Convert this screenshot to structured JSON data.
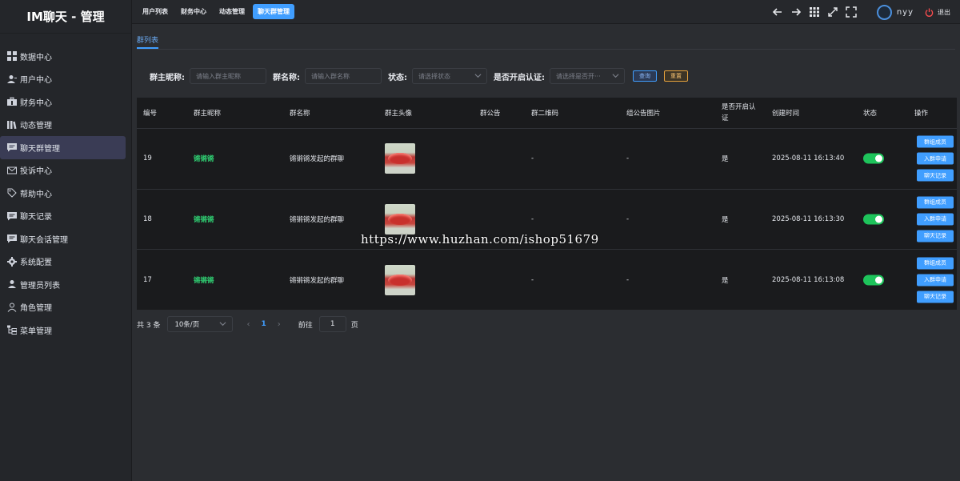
{
  "app": {
    "title": "IM聊天 - 管理"
  },
  "sidebar": {
    "items": [
      {
        "label": "数据中心",
        "icon": "grid-icon",
        "active": false
      },
      {
        "label": "用户中心",
        "icon": "user-icon",
        "active": false
      },
      {
        "label": "财务中心",
        "icon": "briefcase-icon",
        "active": false
      },
      {
        "label": "动态管理",
        "icon": "library-icon",
        "active": false
      },
      {
        "label": "聊天群管理",
        "icon": "chat-icon",
        "active": true
      },
      {
        "label": "投诉中心",
        "icon": "mail-icon",
        "active": false
      },
      {
        "label": "帮助中心",
        "icon": "tag-icon",
        "active": false
      },
      {
        "label": "聊天记录",
        "icon": "chat-icon",
        "active": false
      },
      {
        "label": "聊天会话管理",
        "icon": "chat-icon",
        "active": false
      },
      {
        "label": "系统配置",
        "icon": "gear-icon",
        "active": false
      },
      {
        "label": "管理员列表",
        "icon": "user-icon",
        "active": false
      },
      {
        "label": "角色管理",
        "icon": "user-outline-icon",
        "active": false
      },
      {
        "label": "菜单管理",
        "icon": "tree-icon",
        "active": false
      }
    ]
  },
  "topbar": {
    "tabs": [
      {
        "label": "用户列表",
        "active": false
      },
      {
        "label": "财务中心",
        "active": false
      },
      {
        "label": "动态管理",
        "active": false
      },
      {
        "label": "聊天群管理",
        "active": true
      }
    ],
    "username": "nyy",
    "logout_label": "退出"
  },
  "subtabs": {
    "active": "群列表"
  },
  "filters": {
    "owner_label": "群主昵称:",
    "owner_placeholder": "请输入群主昵称",
    "group_label": "群名称:",
    "group_placeholder": "请输入群名称",
    "status_label": "状态:",
    "status_placeholder": "请选择状态",
    "verify_label": "是否开启认证:",
    "verify_placeholder": "请选择是否开···",
    "query_label": "查询",
    "reset_label": "重置"
  },
  "table": {
    "headers": {
      "id": "编号",
      "owner": "群主昵称",
      "name": "群名称",
      "avatar": "群主头像",
      "notice": "群公告",
      "qrcode": "群二维码",
      "notice_img": "组公告图片",
      "verify_line1": "是否开启认",
      "verify_line2": "证",
      "created": "创建时间",
      "status": "状态",
      "actions": "操作"
    },
    "rows": [
      {
        "id": "19",
        "owner": "锵锵锵",
        "name": "锵锵锵发起的群聊",
        "qrcode": "-",
        "notice_img": "-",
        "verify": "是",
        "created": "2025-08-11 16:13:40",
        "status_on": true
      },
      {
        "id": "18",
        "owner": "锵锵锵",
        "name": "锵锵锵发起的群聊",
        "qrcode": "-",
        "notice_img": "-",
        "verify": "是",
        "created": "2025-08-11 16:13:30",
        "status_on": true
      },
      {
        "id": "17",
        "owner": "锵锵锵",
        "name": "锵锵锵发起的群聊",
        "qrcode": "-",
        "notice_img": "-",
        "verify": "是",
        "created": "2025-08-11 16:13:08",
        "status_on": true
      }
    ],
    "actions": {
      "members": "群组成员",
      "join_requests": "入群申请",
      "chat_log": "聊天记录"
    }
  },
  "pager": {
    "total": "共 3 条",
    "page_size": "10条/页",
    "current_page": "1",
    "goto_label": "前往",
    "goto_value": "1",
    "page_suffix": "页"
  },
  "watermark": "https://www.huzhan.com/ishop51679",
  "colors": {
    "accent": "#409eff",
    "success": "#1ec45b",
    "warning": "#e6a23c",
    "owner_text": "#2fcc71"
  }
}
